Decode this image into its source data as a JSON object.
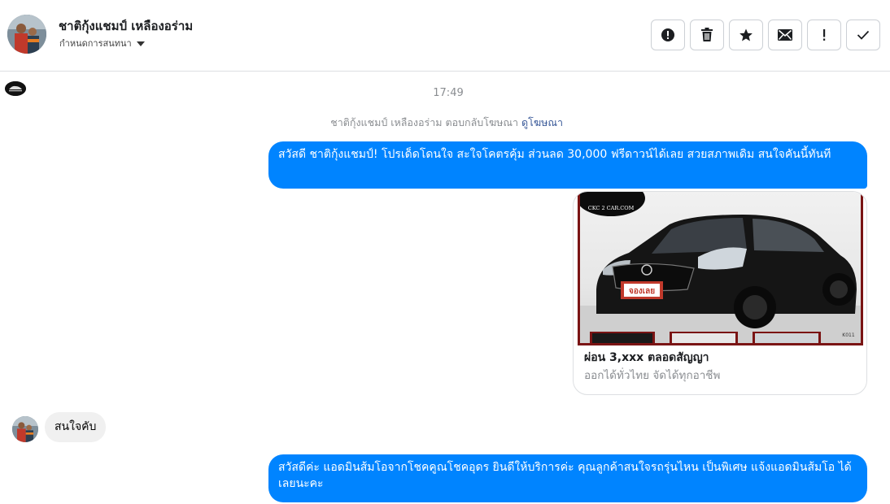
{
  "header": {
    "contact_name": "ชาติกุ้งแชมป์ เหลืองอร่าม",
    "conversation_settings_label": "กำหนดการสนทนา",
    "actions": [
      {
        "icon": "alert-circle-icon",
        "name": "mark-spam-button"
      },
      {
        "icon": "trash-icon",
        "name": "delete-button"
      },
      {
        "icon": "star-icon",
        "name": "star-button"
      },
      {
        "icon": "envelope-icon",
        "name": "mark-unread-button"
      },
      {
        "icon": "exclamation-icon",
        "name": "follow-up-button"
      },
      {
        "icon": "checkmark-icon",
        "name": "mark-done-button"
      }
    ]
  },
  "conversation": {
    "timestamp": "17:49",
    "ad_context_text": "ชาติกุ้งแชมป์ เหลืองอร่าม ตอบกลับโฆษณา",
    "view_ad_link": "ดูโฆษณา",
    "messages": [
      {
        "direction": "outgoing",
        "text": "สวัสดี ชาติกุ้งแชมป์! โปรเด็ดโดนใจ สะใจโคตรคุ้ม ส่วนลด 30,000 ฟรีดาวน์ได้เลย สวยสภาพเดิม สนใจคันนี้ทันที"
      },
      {
        "direction": "outgoing",
        "type": "ad_card",
        "title": "ผ่อน 3,xxx ตลอดสัญญา",
        "subtitle": "ออกได้ทั่วไทย จัดได้ทุกอาชีพ",
        "image_logo_text": "CKC 2 CAR.COM",
        "image_sticker_text": "จองเลย",
        "image_stock_code": "K011"
      },
      {
        "direction": "incoming",
        "text": "สนใจคับ"
      },
      {
        "direction": "outgoing",
        "text": "สวัสดีค่ะ แอดมินส้มโอจากโชคคูณโชคอุดร ยินดีให้บริการค่ะ   คุณลูกค้าสนใจรถรุ่นไหน เป็นพิเศษ แจ้งแอดมินส้มโอ ได้เลยนะคะ"
      }
    ]
  },
  "colors": {
    "outgoing_bubble": "#0084ff",
    "incoming_bubble": "#f0f0f0",
    "link": "#385898",
    "muted_text": "#8a8d91",
    "ad_frame": "#7a1414"
  }
}
